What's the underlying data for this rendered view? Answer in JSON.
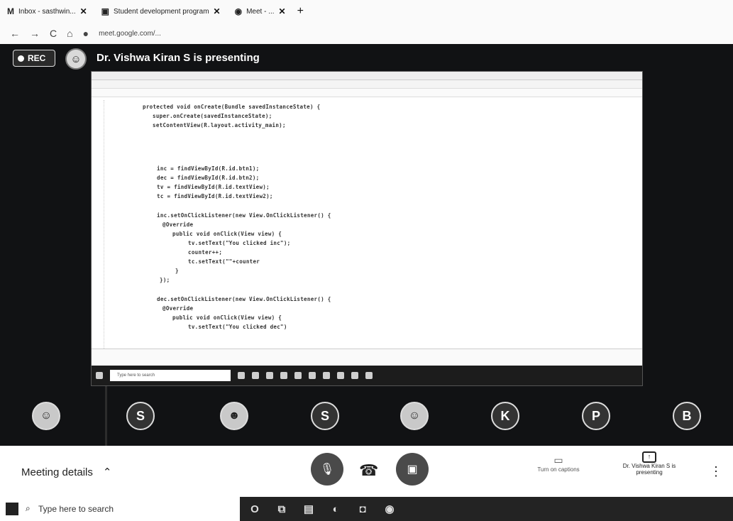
{
  "browser": {
    "tabs": [
      {
        "icon": "gmail-icon",
        "title": "Inbox - sasthwin...",
        "close": "✕"
      },
      {
        "icon": "classroom-icon",
        "title": "Student development program",
        "close": "✕"
      },
      {
        "icon": "meet-icon",
        "title": "Meet - ...",
        "close": "✕"
      }
    ],
    "new_tab": "+",
    "url": "meet.google.com/..."
  },
  "meet": {
    "rec_label": "REC",
    "presenting_text": "Dr. Vishwa Kiran S is presenting",
    "participants": [
      {
        "initial": "",
        "type": "photo"
      },
      {
        "initial": "S",
        "type": "letter"
      },
      {
        "initial": "",
        "type": "photo"
      },
      {
        "initial": "S",
        "type": "letter"
      },
      {
        "initial": "",
        "type": "photo"
      },
      {
        "initial": "K",
        "type": "letter"
      },
      {
        "initial": "P",
        "type": "letter"
      },
      {
        "initial": "B",
        "type": "letter"
      }
    ],
    "shared_screen": {
      "code_lines": [
        "protected void onCreate(Bundle savedInstanceState) {",
        "super.onCreate(savedInstanceState);",
        "setContentView(R.layout.activity_main);",
        "inc = findViewById(R.id.btn1);",
        "dec = findViewById(R.id.btn2);",
        "tv = findViewById(R.id.textView);",
        "tc = findViewById(R.id.textView2);",
        "inc.setOnClickListener(new View.OnClickListener() {",
        "@Override",
        "public void onClick(View view) {",
        "tv.setText(\"You clicked inc\");",
        "counter++;",
        "tc.setText(\"\"+counter",
        "}",
        "});",
        "dec.setOnClickListener(new View.OnClickListener() {",
        "@Override",
        "public void onClick(View view) {",
        "tv.setText(\"You clicked dec\")"
      ],
      "taskbar_search": "Type here to search"
    }
  },
  "controls": {
    "meeting_details": "Meeting details",
    "captions_label": "Turn on captions",
    "present_label": "Dr. Vishwa Kiran S is presenting",
    "more": "⋮"
  },
  "taskbar": {
    "search_placeholder": "Type here to search"
  }
}
